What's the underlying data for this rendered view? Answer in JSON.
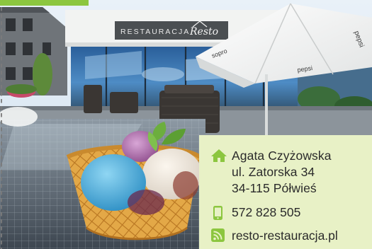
{
  "restaurant_sign": {
    "text": "RESTAURACJA",
    "logo_script": "Resto"
  },
  "contact": {
    "name": "Agata Czyżowska",
    "street": "ul. Zatorska 34",
    "postal_city": "34-115 Półwieś",
    "phone": "572 828 505",
    "website": "resto-restauracja.pl"
  },
  "icons": {
    "address": "home-icon",
    "phone": "mobile-phone-icon",
    "website": "rss-icon"
  },
  "colors": {
    "accent_green": "#8cc63f",
    "card_background": "#e8f1c6",
    "text": "#2b2b2b"
  }
}
